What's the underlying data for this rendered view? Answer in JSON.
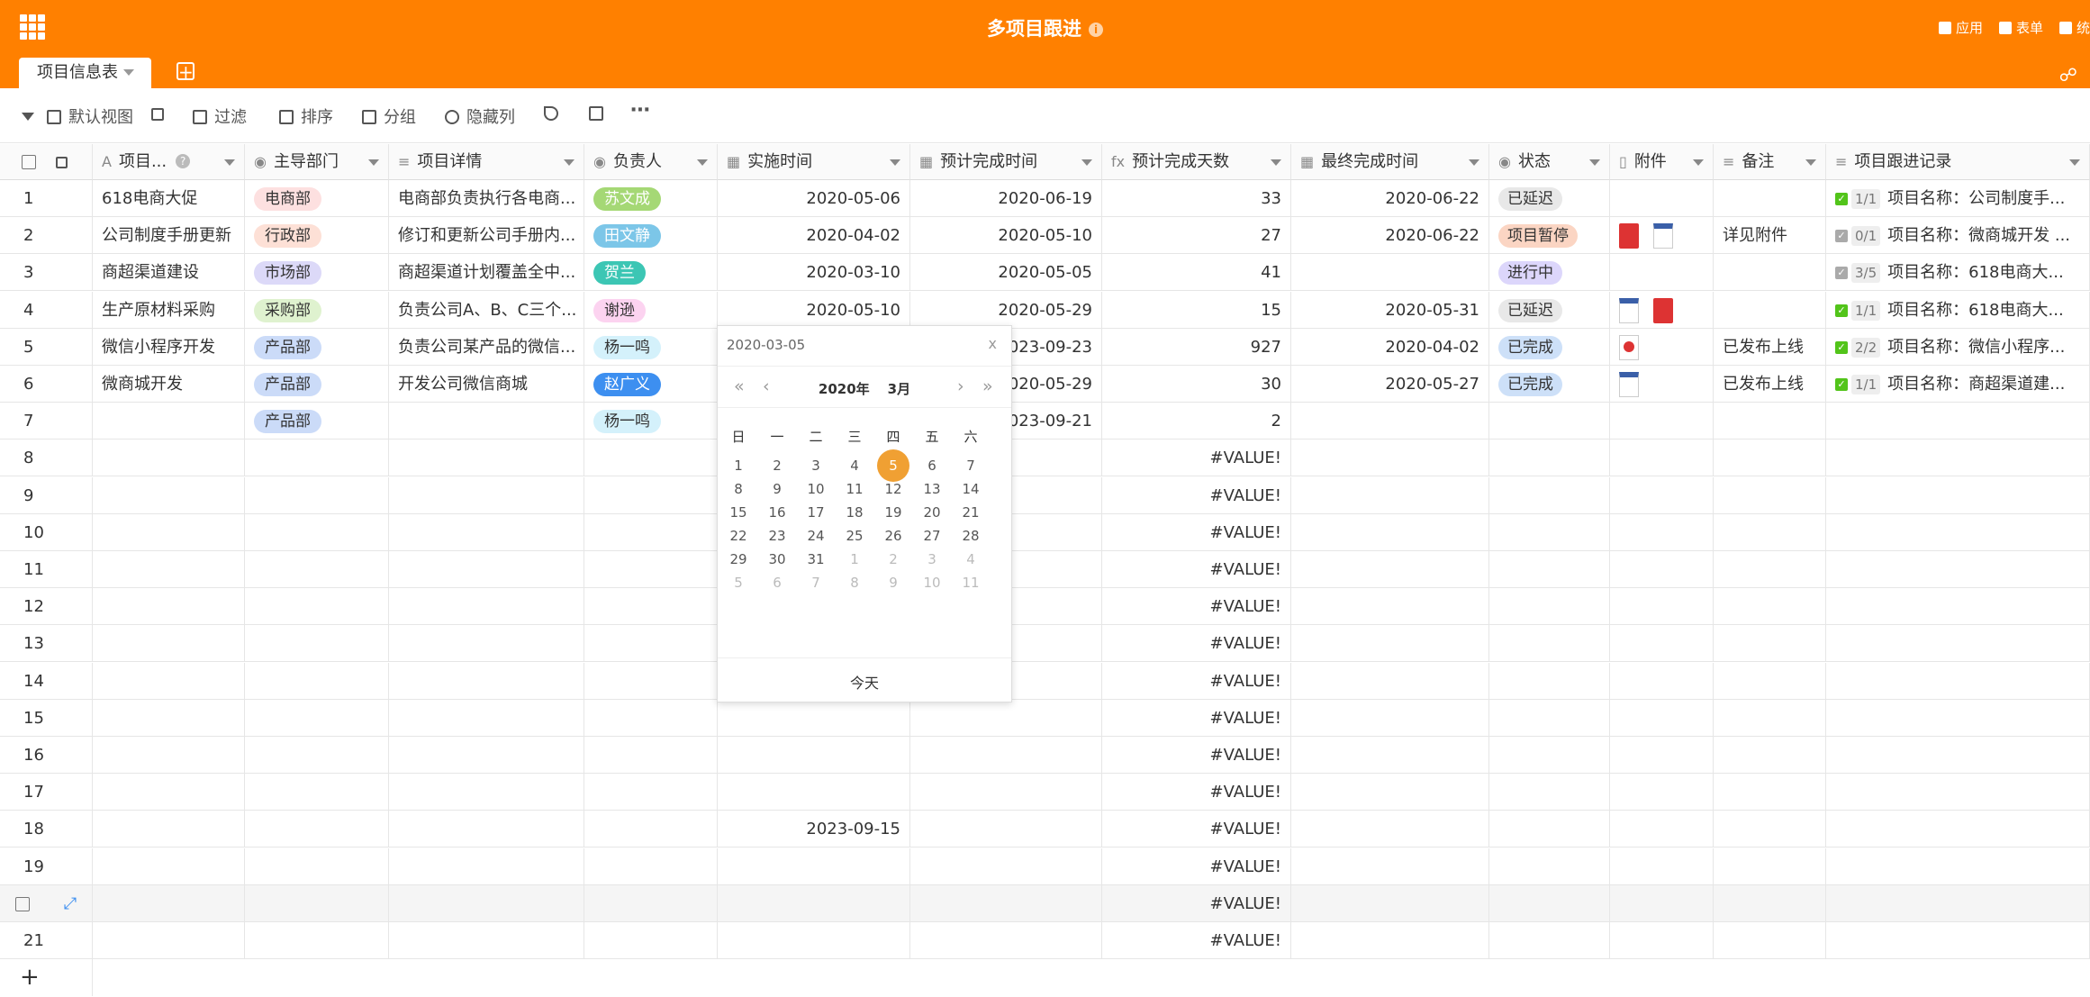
{
  "app": {
    "title": "多项目跟进",
    "info_icon": "info-icon",
    "right_actions": [
      "应用",
      "表单",
      "统"
    ],
    "tab": "项目信息表"
  },
  "toolbar": {
    "view": "默认视图",
    "filter": "过滤",
    "sort": "排序",
    "group": "分组",
    "hide": "隐藏列"
  },
  "columns": [
    "项目...",
    "主导部门",
    "项目详情",
    "负责人",
    "实施时间",
    "预计完成时间",
    "预计完成天数",
    "最终完成时间",
    "状态",
    "附件",
    "备注",
    "项目跟进记录"
  ],
  "colors": {
    "topbar": "#ff8000",
    "selected_day": "#f0a033"
  },
  "rows": [
    {
      "idx": "1",
      "name": "618电商大促",
      "dept": "电商部",
      "dept_bg": "#fde0e0",
      "detail": "电商部负责执行各电商...",
      "owner": "苏文成",
      "owner_bg": "#a5d875",
      "owner_fg": "#ffffff",
      "start": "2020-05-06",
      "plan": "2020-06-19",
      "days": "33",
      "final": "2020-06-22",
      "status": "已延迟",
      "status_bg": "#e8e8e8",
      "attach": [],
      "note": "",
      "rec_count": "1/1",
      "rec_checked": true,
      "rec": "项目名称：公司制度手..."
    },
    {
      "idx": "2",
      "name": "公司制度手册更新",
      "dept": "行政部",
      "dept_bg": "#fde0d6",
      "detail": "修订和更新公司手册内...",
      "owner": "田文静",
      "owner_bg": "#7cc6e8",
      "owner_fg": "#ffffff",
      "start": "2020-04-02",
      "plan": "2020-05-10",
      "days": "27",
      "final": "2020-06-22",
      "status": "项目暂停",
      "status_bg": "#fbd5c3",
      "attach": [
        "pdf",
        "doc"
      ],
      "note": "详见附件",
      "rec_count": "0/1",
      "rec_checked": false,
      "rec": "项目名称：微商城开发 ..."
    },
    {
      "idx": "3",
      "name": "商超渠道建设",
      "dept": "市场部",
      "dept_bg": "#dcd9f8",
      "detail": "商超渠道计划覆盖全中...",
      "owner": "贺兰",
      "owner_bg": "#3cc6b4",
      "owner_fg": "#ffffff",
      "start": "2020-03-10",
      "plan": "2020-05-05",
      "days": "41",
      "final": "",
      "status": "进行中",
      "status_bg": "#dcd6fb",
      "attach": [],
      "note": "",
      "rec_count": "3/5",
      "rec_checked": false,
      "rec": "项目名称：618电商大..."
    },
    {
      "idx": "4",
      "name": "生产原材料采购",
      "dept": "采购部",
      "dept_bg": "#dff2cf",
      "detail": "负责公司A、B、C三个...",
      "owner": "谢逊",
      "owner_bg": "#fcd3f0",
      "owner_fg": "#333333",
      "start": "2020-05-10",
      "plan": "2020-05-29",
      "days": "15",
      "final": "2020-05-31",
      "status": "已延迟",
      "status_bg": "#e8e8e8",
      "attach": [
        "doc",
        "pdf"
      ],
      "note": "",
      "rec_count": "1/1",
      "rec_checked": true,
      "rec": "项目名称：618电商大..."
    },
    {
      "idx": "5",
      "name": "微信小程序开发",
      "dept": "产品部",
      "dept_bg": "#cbdbf8",
      "detail": "负责公司某产品的微信...",
      "owner": "杨一鸣",
      "owner_bg": "#d4f1fb",
      "owner_fg": "#333333",
      "start": "",
      "plan": "2023-09-23",
      "days": "927",
      "final": "2020-04-02",
      "status": "已完成",
      "status_bg": "#cde0f8",
      "attach": [
        "ppt"
      ],
      "note": "已发布上线",
      "rec_count": "2/2",
      "rec_checked": true,
      "rec": "项目名称：微信小程序..."
    },
    {
      "idx": "6",
      "name": "微商城开发",
      "dept": "产品部",
      "dept_bg": "#cbdbf8",
      "detail": "开发公司微信商城",
      "owner": "赵广义",
      "owner_bg": "#3d8ff0",
      "owner_fg": "#ffffff",
      "start": "",
      "plan": "2020-05-29",
      "days": "30",
      "final": "2020-05-27",
      "status": "已完成",
      "status_bg": "#cde0f8",
      "attach": [
        "doc"
      ],
      "note": "已发布上线",
      "rec_count": "1/1",
      "rec_checked": true,
      "rec": "项目名称：商超渠道建..."
    },
    {
      "idx": "7",
      "name": "",
      "dept": "产品部",
      "dept_bg": "#cbdbf8",
      "detail": "",
      "owner": "杨一鸣",
      "owner_bg": "#d4f1fb",
      "owner_fg": "#333333",
      "start": "",
      "plan": "2023-09-21",
      "days": "2",
      "final": "",
      "status": "",
      "status_bg": "",
      "attach": [],
      "note": "",
      "rec_count": "",
      "rec_checked": false,
      "rec": ""
    },
    {
      "idx": "8",
      "days": "#VALUE!"
    },
    {
      "idx": "9",
      "days": "#VALUE!"
    },
    {
      "idx": "10",
      "days": "#VALUE!"
    },
    {
      "idx": "11",
      "days": "#VALUE!"
    },
    {
      "idx": "12",
      "days": "#VALUE!"
    },
    {
      "idx": "13",
      "days": "#VALUE!"
    },
    {
      "idx": "14",
      "days": "#VALUE!"
    },
    {
      "idx": "15",
      "days": "#VALUE!"
    },
    {
      "idx": "16",
      "days": "#VALUE!"
    },
    {
      "idx": "17",
      "days": "#VALUE!"
    },
    {
      "idx": "18",
      "start": "2023-09-15",
      "days": "#VALUE!"
    },
    {
      "idx": "19",
      "days": "#VALUE!"
    },
    {
      "idx": "",
      "days": "#VALUE!",
      "hover": true
    },
    {
      "idx": "21",
      "days": "#VALUE!"
    }
  ],
  "add_row_label": "+",
  "datepicker": {
    "input_value": "2020-03-05",
    "close": "x",
    "year": "2020年",
    "month": "3月",
    "nav_prev_year": "«",
    "nav_prev_month": "‹",
    "nav_next_month": "›",
    "nav_next_year": "»",
    "weekdays": [
      "日",
      "一",
      "二",
      "三",
      "四",
      "五",
      "六"
    ],
    "weeks": [
      [
        "1",
        "2",
        "3",
        "4",
        "5",
        "6",
        "7"
      ],
      [
        "8",
        "9",
        "10",
        "11",
        "12",
        "13",
        "14"
      ],
      [
        "15",
        "16",
        "17",
        "18",
        "19",
        "20",
        "21"
      ],
      [
        "22",
        "23",
        "24",
        "25",
        "26",
        "27",
        "28"
      ],
      [
        "29",
        "30",
        "31",
        "1",
        "2",
        "3",
        "4"
      ],
      [
        "5",
        "6",
        "7",
        "8",
        "9",
        "10",
        "11"
      ]
    ],
    "selected": "5",
    "today_label": "今天"
  }
}
